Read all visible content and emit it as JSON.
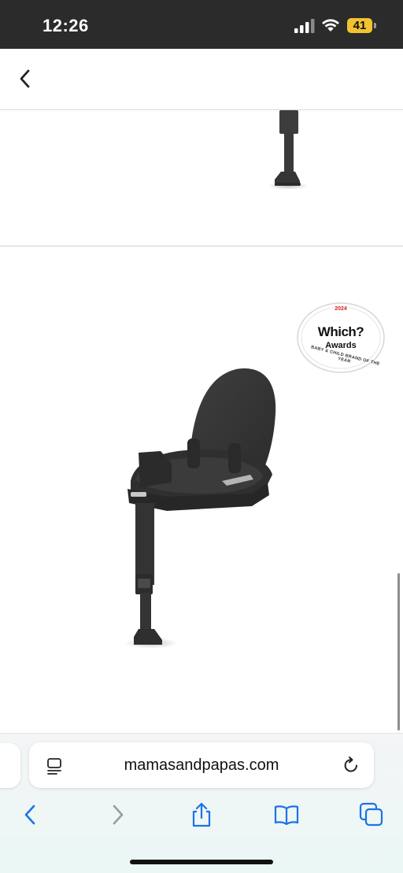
{
  "status_bar": {
    "time": "12:26",
    "battery": "41"
  },
  "badge": {
    "year": "2024",
    "title": "Which?",
    "subtitle": "Awards",
    "tagline": "BABY & CHILD BRAND OF THE YEAR"
  },
  "browser": {
    "url": "mamasandpapas.com"
  },
  "icons": {
    "back": "chevron-left-icon",
    "page_settings": "page-settings-icon",
    "reload": "reload-icon",
    "toolbar": [
      "chevron-left-icon",
      "chevron-right-icon",
      "share-icon",
      "book-icon",
      "tabs-icon"
    ]
  },
  "colors": {
    "status_bar": "#2b2b2b",
    "battery": "#f2c230",
    "ios_blue": "#1a73e8",
    "product": "#3a3a3a"
  }
}
